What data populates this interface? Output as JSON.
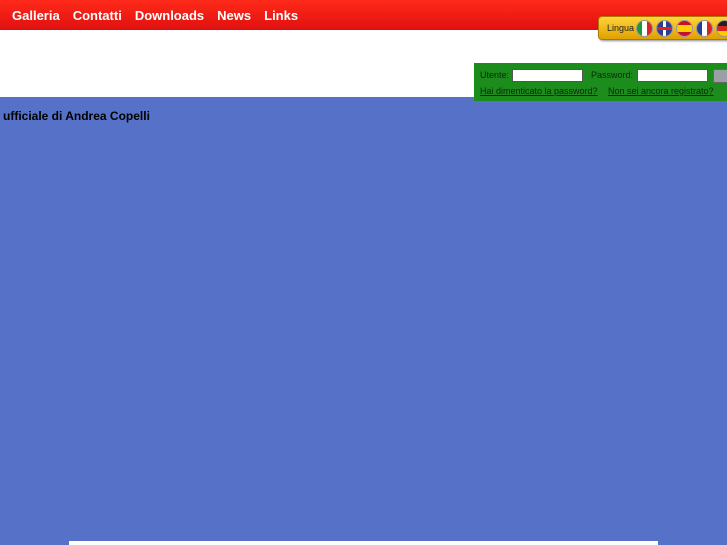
{
  "nav": {
    "items": [
      {
        "label": "Galleria"
      },
      {
        "label": "Contatti"
      },
      {
        "label": "Downloads"
      },
      {
        "label": "News"
      },
      {
        "label": "Links"
      }
    ]
  },
  "language": {
    "label": "Lingua",
    "flags": [
      "italian-flag-icon",
      "english-flag-icon",
      "spanish-flag-icon",
      "french-flag-icon",
      "german-flag-icon"
    ]
  },
  "login": {
    "user_label": "Utente:",
    "password_label": "Password:",
    "forgot_password": "Hai dimenticato la password?",
    "not_registered": "Non sei ancora registrato?"
  },
  "content": {
    "headline": "ufficiale di Andrea Copelli"
  },
  "colors": {
    "topbar": "#e81a12",
    "background": "#5572c8",
    "login_panel": "#1c8c1c",
    "language_bar": "#f0b800"
  }
}
